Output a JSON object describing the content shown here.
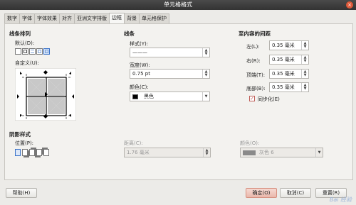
{
  "window": {
    "title": "单元格格式",
    "close": "×"
  },
  "tabs": [
    "数字",
    "字体",
    "字体效果",
    "对齐",
    "亚洲文字排版",
    "边框",
    "背景",
    "单元格保护"
  ],
  "active_tab": 5,
  "line_arrangement": {
    "title": "线条排列",
    "default_label": "默认(D):",
    "custom_label": "自定义(U):"
  },
  "line": {
    "title": "线条",
    "style_label": "样式(Y):",
    "style_value": "———",
    "width_label": "宽度(W):",
    "width_value": "0.75 pt",
    "color_label": "颜色(C):",
    "color_value": "黑色"
  },
  "padding": {
    "title": "至内容的间距",
    "left_label": "左(L):",
    "left_value": "0.35 毫米",
    "right_label": "右(R):",
    "right_value": "0.35 毫米",
    "top_label": "顶端(T):",
    "top_value": "0.35 毫米",
    "bottom_label": "底部(B):",
    "bottom_value": "0.35 毫米",
    "sync_label": "同步化(E)",
    "sync_checked": true
  },
  "shadow": {
    "title": "阴影样式",
    "position_label": "位置(P):",
    "distance_label": "距离(C):",
    "distance_value": "1.76 毫米",
    "color_label": "颜色(O):",
    "color_value": "灰色 6"
  },
  "buttons": {
    "help": "帮助(H)",
    "ok": "确定(O)",
    "cancel": "取消(C)",
    "reset": "重置(R)"
  },
  "watermark": "Bai 经验"
}
